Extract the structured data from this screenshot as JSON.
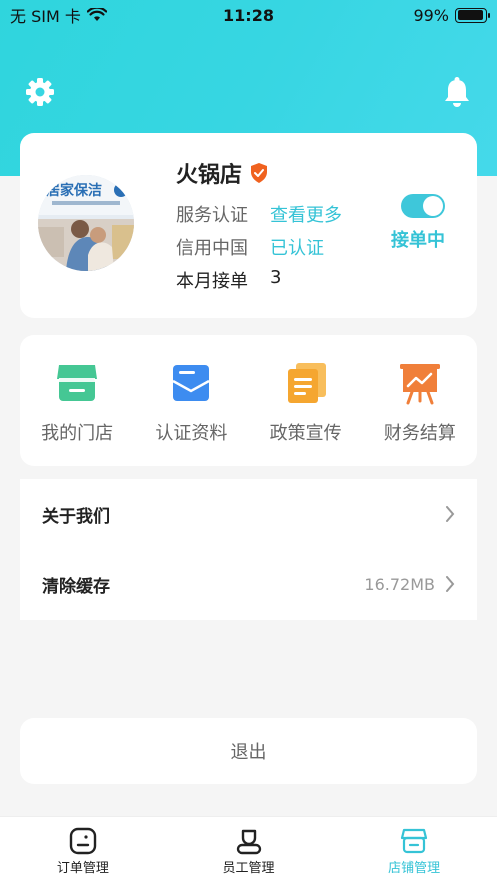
{
  "status_bar": {
    "carrier": "无 SIM 卡",
    "time": "11:28",
    "battery": "99%"
  },
  "header": {
    "settings_icon": "gear-icon",
    "notification_icon": "bell-icon"
  },
  "profile": {
    "store_name": "火锅店",
    "verified_icon": "shield-check-icon",
    "avatar_banner_text": "居家保洁",
    "rows": [
      {
        "label": "服务认证",
        "value": "查看更多"
      },
      {
        "label": "信用中国",
        "value": "已认证"
      },
      {
        "label": "本月接单",
        "value": "3"
      }
    ],
    "toggle_label": "接单中",
    "toggle_on": true,
    "accent_color": "#35c3d6"
  },
  "features": [
    {
      "label": "我的门店",
      "icon": "store-icon",
      "color": "#45c794"
    },
    {
      "label": "认证资料",
      "icon": "mail-icon",
      "color": "#3d8cf0"
    },
    {
      "label": "政策宣传",
      "icon": "documents-icon",
      "color": "#f5a630"
    },
    {
      "label": "财务结算",
      "icon": "presentation-chart-icon",
      "color": "#f07f3a"
    }
  ],
  "list": [
    {
      "title": "关于我们",
      "value": ""
    },
    {
      "title": "清除缓存",
      "value": "16.72MB"
    }
  ],
  "logout_label": "退出",
  "tabs": [
    {
      "label": "订单管理",
      "icon": "order-icon"
    },
    {
      "label": "员工管理",
      "icon": "staff-icon"
    },
    {
      "label": "店铺管理",
      "icon": "shop-icon",
      "active": true
    }
  ]
}
